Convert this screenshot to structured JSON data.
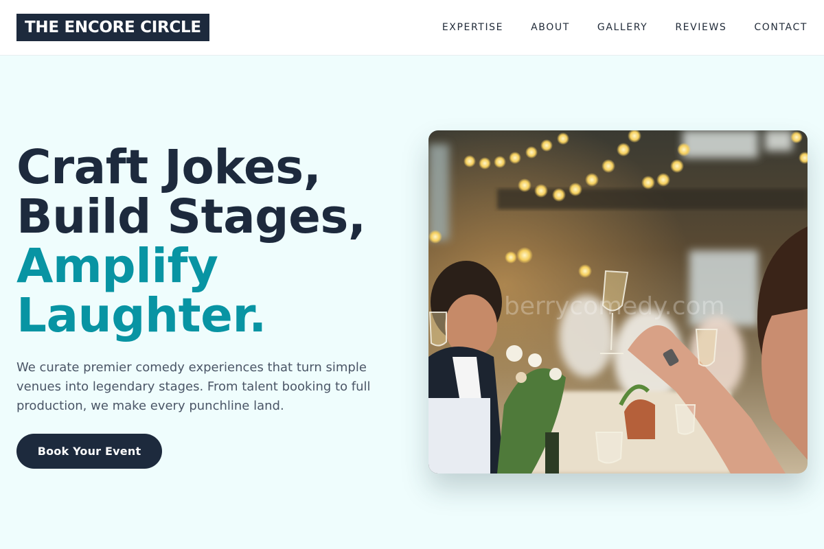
{
  "brand": {
    "name": "THE ENCORE CIRCLE"
  },
  "nav": {
    "items": [
      "EXPERTISE",
      "ABOUT",
      "GALLERY",
      "REVIEWS",
      "CONTACT"
    ]
  },
  "hero": {
    "title_line1": "Craft Jokes,",
    "title_line2": "Build Stages,",
    "title_line3": "Amplify",
    "title_line4": "Laughter.",
    "description": "We curate premier comedy experiences that turn simple venues into legendary stages. From talent booking to full production, we make every punchline land.",
    "cta_label": "Book Your Event"
  },
  "photo": {
    "watermark": "berrycomedy.com",
    "alt": "Guests raising champagne glasses at a banquet under string lights"
  },
  "colors": {
    "navy": "#1d2a3d",
    "teal": "#0894a3",
    "background": "#effdfd"
  }
}
